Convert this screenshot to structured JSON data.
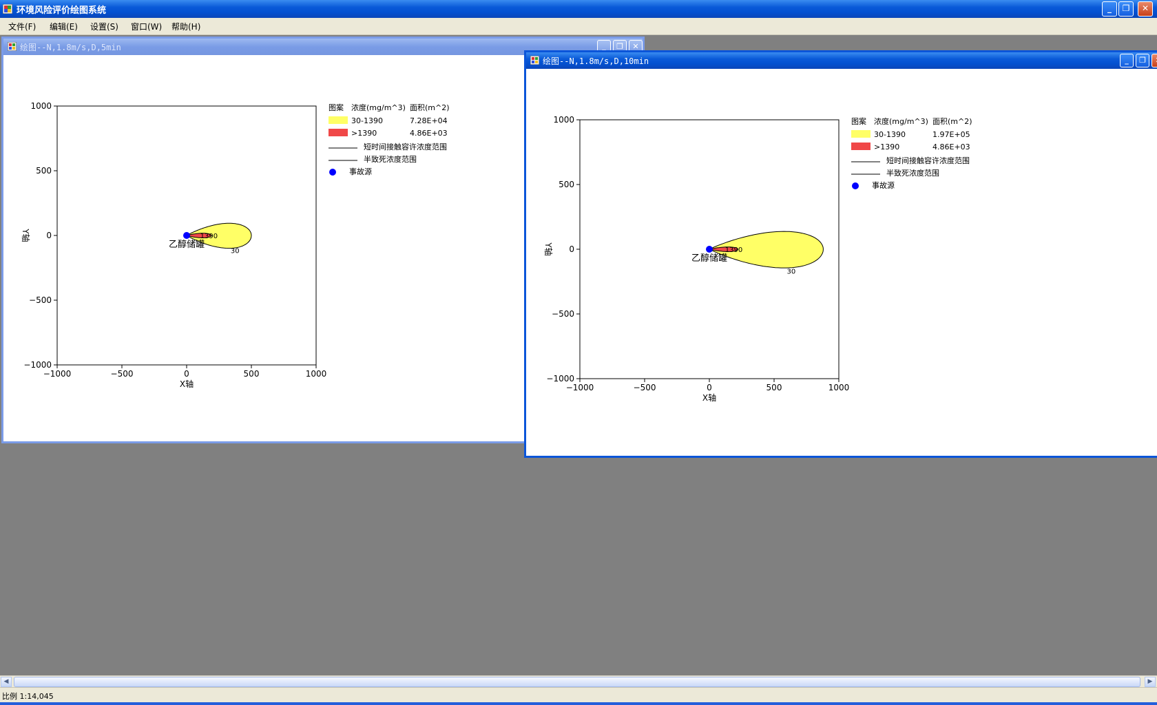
{
  "app": {
    "title": "环境风险评价绘图系统",
    "caption_buttons": {
      "minimize": "_",
      "restore": "❐",
      "close": "✕"
    }
  },
  "menu": [
    {
      "label": "文件(F)"
    },
    {
      "label": "编辑(E)"
    },
    {
      "label": "设置(S)"
    },
    {
      "label": "窗口(W)"
    },
    {
      "label": "帮助(H)"
    }
  ],
  "windows": [
    {
      "title": "绘图--N,1.8m/s,D,5min",
      "active": false,
      "source_label": "乙醇储罐",
      "x_axis_label": "X轴",
      "y_axis_label": "Y轴",
      "x_ticks": [
        "−1000",
        "−500",
        "0",
        "500",
        "1000"
      ],
      "y_ticks": [
        "1000",
        "500",
        "0",
        "−500",
        "−1000"
      ],
      "contour_labels": {
        "high": "1390",
        "low": "30"
      },
      "legend": {
        "header": {
          "pattern": "图案",
          "concentration": "浓度(mg/m^3)",
          "area": "面积(m^2)"
        },
        "rows": [
          {
            "range": "30-1390",
            "area": "7.28E+04",
            "color": "#ffff66"
          },
          {
            "range": ">1390",
            "area": "4.86E+03",
            "color": "#f04848"
          }
        ],
        "line1": "短时间接触容许浓度范围",
        "line2": "半致死浓度范围",
        "point": "事故源",
        "point_color": "#0000ff"
      },
      "chart_data": {
        "type": "area",
        "xlim": [
          -1000,
          1000
        ],
        "ylim": [
          -1000,
          1000
        ],
        "xlabel": "X轴",
        "ylabel": "Y轴",
        "source": {
          "x": 0,
          "y": 0,
          "label": "乙醇储罐"
        },
        "plume_30": {
          "x_max": 500,
          "half_width": 120
        },
        "plume_1390": {
          "x_max": 190,
          "half_width": 22
        }
      }
    },
    {
      "title": "绘图--N,1.8m/s,D,10min",
      "active": true,
      "source_label": "乙醇储罐",
      "x_axis_label": "X轴",
      "y_axis_label": "Y轴",
      "x_ticks": [
        "−1000",
        "−500",
        "0",
        "500",
        "1000"
      ],
      "y_ticks": [
        "1000",
        "500",
        "0",
        "−500",
        "−1000"
      ],
      "contour_labels": {
        "high": "1390",
        "low": "30"
      },
      "legend": {
        "header": {
          "pattern": "图案",
          "concentration": "浓度(mg/m^3)",
          "area": "面积(m^2)"
        },
        "rows": [
          {
            "range": "30-1390",
            "area": "1.97E+05",
            "color": "#ffff66"
          },
          {
            "range": ">1390",
            "area": "4.86E+03",
            "color": "#f04848"
          }
        ],
        "line1": "短时间接触容许浓度范围",
        "line2": "半致死浓度范围",
        "point": "事故源",
        "point_color": "#0000ff"
      },
      "chart_data": {
        "type": "area",
        "xlim": [
          -1000,
          1000
        ],
        "ylim": [
          -1000,
          1000
        ],
        "xlabel": "X轴",
        "ylabel": "Y轴",
        "source": {
          "x": 0,
          "y": 0,
          "label": "乙醇储罐"
        },
        "plume_30": {
          "x_max": 880,
          "half_width": 175
        },
        "plume_1390": {
          "x_max": 220,
          "half_width": 22
        }
      }
    }
  ],
  "status": {
    "scale": "比例 1:14,045"
  },
  "scrollbar": {
    "left_arrow": "◀",
    "right_arrow": "▶"
  }
}
